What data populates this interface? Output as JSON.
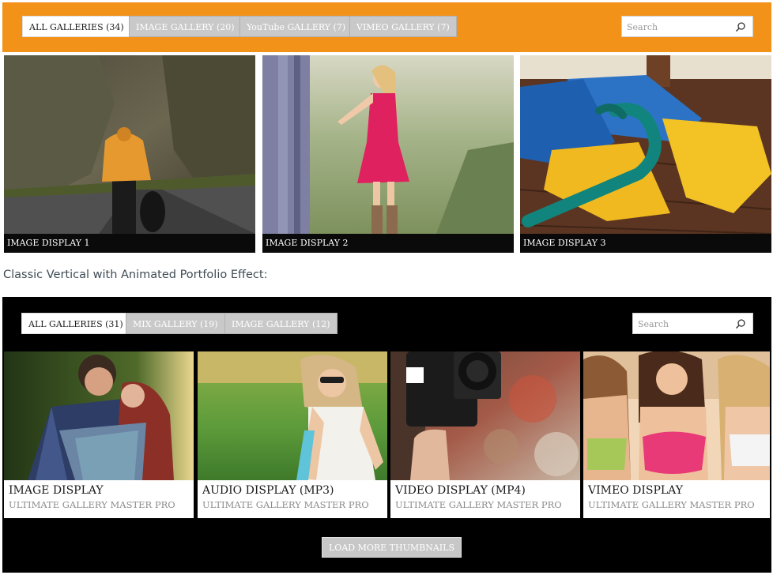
{
  "top_gallery": {
    "filters": [
      {
        "label": "ALL GALLERIES (34)",
        "active": true
      },
      {
        "label": "IMAGE GALLERY (20)",
        "active": false
      },
      {
        "label": "YouTube GALLERY (7)",
        "active": false
      },
      {
        "label": "VIMEO GALLERY (7)",
        "active": false
      }
    ],
    "search_placeholder": "Search",
    "accent_color": "#f39219",
    "tiles": [
      {
        "caption": "IMAGE DISPLAY 1"
      },
      {
        "caption": "IMAGE DISPLAY 2"
      },
      {
        "caption": "IMAGE DISPLAY 3"
      }
    ]
  },
  "section_heading": "Classic Vertical with Animated Portfolio Effect:",
  "portfolio": {
    "filters": [
      {
        "label": "ALL GALLERIES (31)",
        "active": true
      },
      {
        "label": "MIX GALLERY (19)",
        "active": false
      },
      {
        "label": "IMAGE GALLERY (12)",
        "active": false
      }
    ],
    "search_placeholder": "Search",
    "cards": [
      {
        "title": "IMAGE DISPLAY",
        "subtitle": "ULTIMATE GALLERY MASTER PRO"
      },
      {
        "title": "AUDIO DISPLAY (MP3)",
        "subtitle": "ULTIMATE GALLERY MASTER PRO"
      },
      {
        "title": "VIDEO DISPLAY (MP4)",
        "subtitle": "ULTIMATE GALLERY MASTER PRO"
      },
      {
        "title": "VIMEO DISPLAY",
        "subtitle": "ULTIMATE GALLERY MASTER PRO"
      }
    ],
    "load_more_label": "LOAD MORE THUMBNAILS"
  }
}
